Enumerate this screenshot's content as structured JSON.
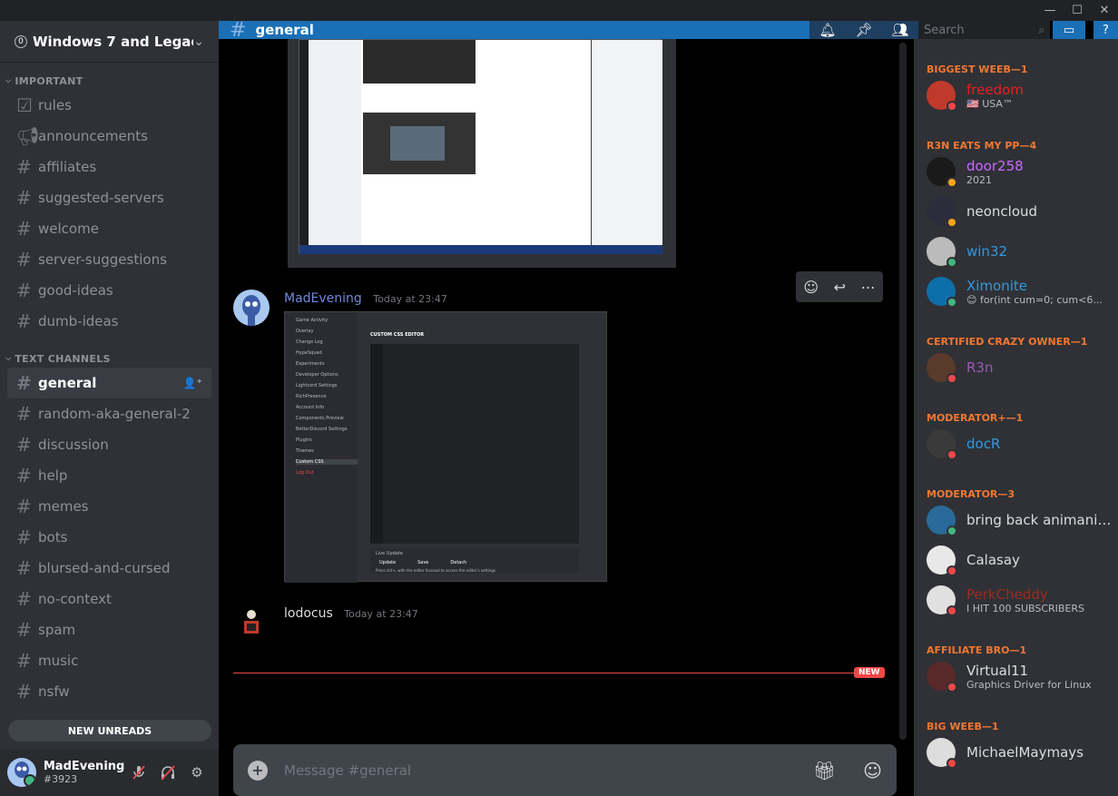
{
  "window": {
    "minimize": "—",
    "maximize": "☐",
    "close": "✕"
  },
  "server": {
    "badge": "0",
    "name": "Windows 7 and Legac...",
    "chevron": "⌄"
  },
  "categories": {
    "important": "IMPORTANT",
    "text": "TEXT CHANNELS"
  },
  "important_channels": [
    {
      "name": "rules",
      "icon": "rules-icon"
    },
    {
      "name": "announcements",
      "icon": "megaphone-icon"
    },
    {
      "name": "affiliates",
      "icon": "hash-icon"
    },
    {
      "name": "suggested-servers",
      "icon": "hash-icon"
    },
    {
      "name": "welcome",
      "icon": "hash-icon"
    },
    {
      "name": "server-suggestions",
      "icon": "hash-icon"
    },
    {
      "name": "good-ideas",
      "icon": "hash-icon"
    },
    {
      "name": "dumb-ideas",
      "icon": "hash-icon"
    }
  ],
  "text_channels": [
    {
      "name": "general"
    },
    {
      "name": "random-aka-general-2"
    },
    {
      "name": "discussion"
    },
    {
      "name": "help"
    },
    {
      "name": "memes"
    },
    {
      "name": "bots"
    },
    {
      "name": "blursed-and-cursed"
    },
    {
      "name": "no-context"
    },
    {
      "name": "spam"
    },
    {
      "name": "music"
    },
    {
      "name": "nsfw"
    }
  ],
  "new_unreads": "NEW UNREADS",
  "user": {
    "name": "MadEvening",
    "tag": "#3923"
  },
  "header": {
    "channel": "general",
    "search_placeholder": "Search"
  },
  "messages": [
    {
      "author": "MadEvening",
      "time": "Today at 23:47",
      "author_color": "#7289da"
    },
    {
      "author": "lodocus",
      "time": "Today at 23:47",
      "author_color": "#dcddde"
    }
  ],
  "shot2": {
    "title": "CUSTOM CSS EDITOR",
    "items": [
      "Game Activity",
      "Overlay",
      "Change Log",
      "HypeSquad",
      "Experiments",
      "Developer Options",
      "Lightcord Settings",
      "RichPresence",
      "Account Info",
      "Components Preview",
      "BetterDiscord Settings",
      "Plugins",
      "Themes",
      "Custom CSS",
      "Log Out"
    ],
    "buttons": [
      "Update",
      "Save",
      "Detach"
    ],
    "live_update": "Live Update",
    "hint": "Press ctrl+, with the editor focused to access the editor's settings."
  },
  "new_badge": "NEW",
  "composer": {
    "placeholder": "Message #general"
  },
  "member_groups": [
    {
      "title": "BIGGEST WEEB—1"
    },
    {
      "title": "R3N EATS MY PP—4"
    },
    {
      "title": "CERTIFIED CRAZY OWNER—1"
    },
    {
      "title": "MODERATOR+—1"
    },
    {
      "title": "MODERATOR—3"
    },
    {
      "title": "AFFILIATE BRO—1"
    },
    {
      "title": "BIG WEEB—1"
    }
  ],
  "members": [
    {
      "name": "freedom",
      "status": "🇺🇸 USA™",
      "color": "#e91e1e",
      "presence": "dnd"
    },
    {
      "name": "door258",
      "status": "2021",
      "color": "#c86bff",
      "presence": "idle"
    },
    {
      "name": "neoncloud",
      "status": "",
      "color": "#dcddde",
      "presence": "idle"
    },
    {
      "name": "win32",
      "status": "",
      "color": "#3498db",
      "presence": "on"
    },
    {
      "name": "Ximonite",
      "status": "😊 for(int cum=0; cum<6...",
      "color": "#3498db",
      "presence": "on"
    },
    {
      "name": "R3n",
      "status": "",
      "color": "#9b59b6",
      "presence": "dnd"
    },
    {
      "name": "docR",
      "status": "",
      "color": "#3498db",
      "presence": "dnd"
    },
    {
      "name": "bring back animanics ...",
      "status": "",
      "color": "#dcddde",
      "presence": "on"
    },
    {
      "name": "Calasay",
      "status": "",
      "color": "#dcddde",
      "presence": "dnd"
    },
    {
      "name": "PerkCheddy",
      "status": "I HIT 100 SUBSCRIBERS",
      "color": "#992d22",
      "presence": "dnd"
    },
    {
      "name": "Virtual11",
      "status": "Graphics Driver for Linux",
      "color": "#dcddde",
      "presence": "dnd"
    },
    {
      "name": "MichaelMaymays",
      "status": "",
      "color": "#dcddde",
      "presence": "dnd"
    }
  ]
}
